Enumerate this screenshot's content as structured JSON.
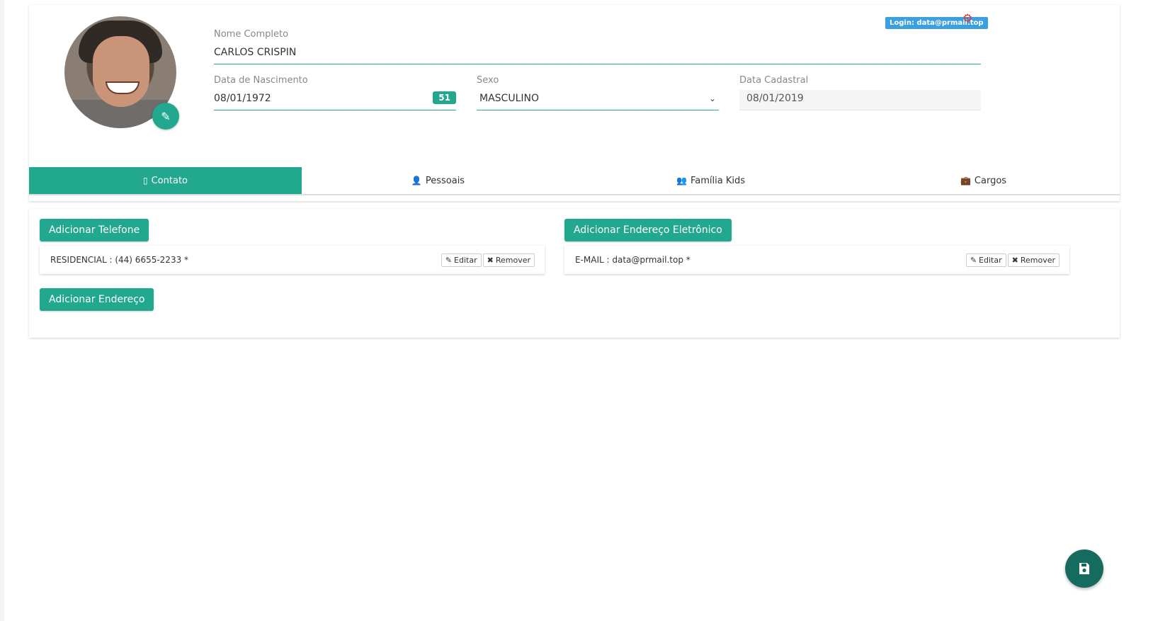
{
  "profile": {
    "full_name_label": "Nome Completo",
    "full_name": "CARLOS CRISPIN",
    "dob_label": "Data de Nascimento",
    "dob": "08/01/1972",
    "age": "51",
    "sex_label": "Sexo",
    "sex": "MASCULINO",
    "registered_label": "Data Cadastral",
    "registered": "08/01/2019",
    "login_badge": "Login: data@prmail.top"
  },
  "tabs": [
    {
      "label": "Contato",
      "icon": "mobile-icon",
      "active": true
    },
    {
      "label": "Pessoais",
      "icon": "user-icon",
      "active": false
    },
    {
      "label": "Família Kids",
      "icon": "users-icon",
      "active": false
    },
    {
      "label": "Cargos",
      "icon": "briefcase-icon",
      "active": false
    }
  ],
  "contact": {
    "add_phone": "Adicionar Telefone",
    "add_email": "Adicionar Endereço Eletrônico",
    "add_address": "Adicionar Endereço",
    "phone_entry": "RESIDENCIAL : (44) 6655-2233 *",
    "email_entry": "E-MAIL : data@prmail.top *",
    "edit_label": "Editar",
    "remove_label": "Remover"
  },
  "colors": {
    "accent": "#22a88f",
    "fab": "#156b5e",
    "login_badge": "#3b9fe0",
    "gear": "#e03a3a"
  }
}
